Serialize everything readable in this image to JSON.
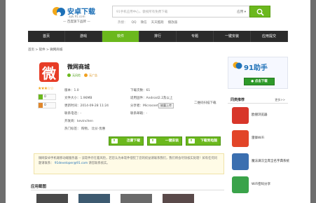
{
  "header": {
    "logo_title": "安卓下载",
    "logo_url": "apk.91.com",
    "logo_slogan": "— 百度旗下品牌 —",
    "search_placeholder": "91手机应用中心，傲视所有免费下载",
    "search_type": "应用 ▾",
    "hot_label": "热搜：",
    "hot_words": [
      "QQ",
      "微信",
      "天天酷跑",
      "播放器"
    ]
  },
  "nav": {
    "items": [
      "首页",
      "游戏",
      "软件",
      "排行",
      "专题",
      "一键安装",
      "应用提交"
    ],
    "active_index": 2
  },
  "breadcrumb": "首页 > 软件 > 微网商城",
  "app": {
    "icon_char": "微",
    "name": "微网商城",
    "badges": [
      "无风险",
      "无广告"
    ],
    "rating_stars": 3.5,
    "stars_text": "★★★☆☆",
    "vote_up": "0",
    "vote_down": "0",
    "version": "版本：1.0",
    "size": "文件大小：1.96MB",
    "updated": "更新时间：2014-09-28 11:24",
    "contact": "联系电话：-",
    "downloads": "下载次数：61",
    "requirements": "适用固件：Android2.2及以上",
    "publisher": "分享者：Microsnet",
    "report_btn": "披露上传",
    "email": "联系邮箱：-",
    "qr_label": "二维码扫描下载",
    "developer": "开发商：kevinchen",
    "tags": "热门标签：  购物，  比价·优惠"
  },
  "downloads_buttons": [
    "迅雷下载",
    "一键安装",
    "下载到电脑"
  ],
  "description": {
    "text": "微网安卓手机端移动端服务器 -- 该软件存在着风险，若您认为本软件侵犯了您的权益请联系我们，我们将会尽快核实处理！如有任何问题请联系：",
    "email": "91developer@91.com",
    "suffix": "请您联系核实。"
  },
  "screenshots_title": "应用截图",
  "sidebar": {
    "promo_title": "91助手",
    "promo_button": "● 点击下载",
    "section_title": "同类推荐",
    "more_label": "更多>>",
    "items": [
      {
        "name": "欧朋浏览器",
        "color": "#d8362a"
      },
      {
        "name": "雷锋WiFi",
        "color": "#e24528"
      },
      {
        "name": "魔法满汉全席全名字典系统",
        "color": "#3b6fb0"
      },
      {
        "name": "WiFi密码分享",
        "color": "#3aa34a"
      }
    ]
  }
}
